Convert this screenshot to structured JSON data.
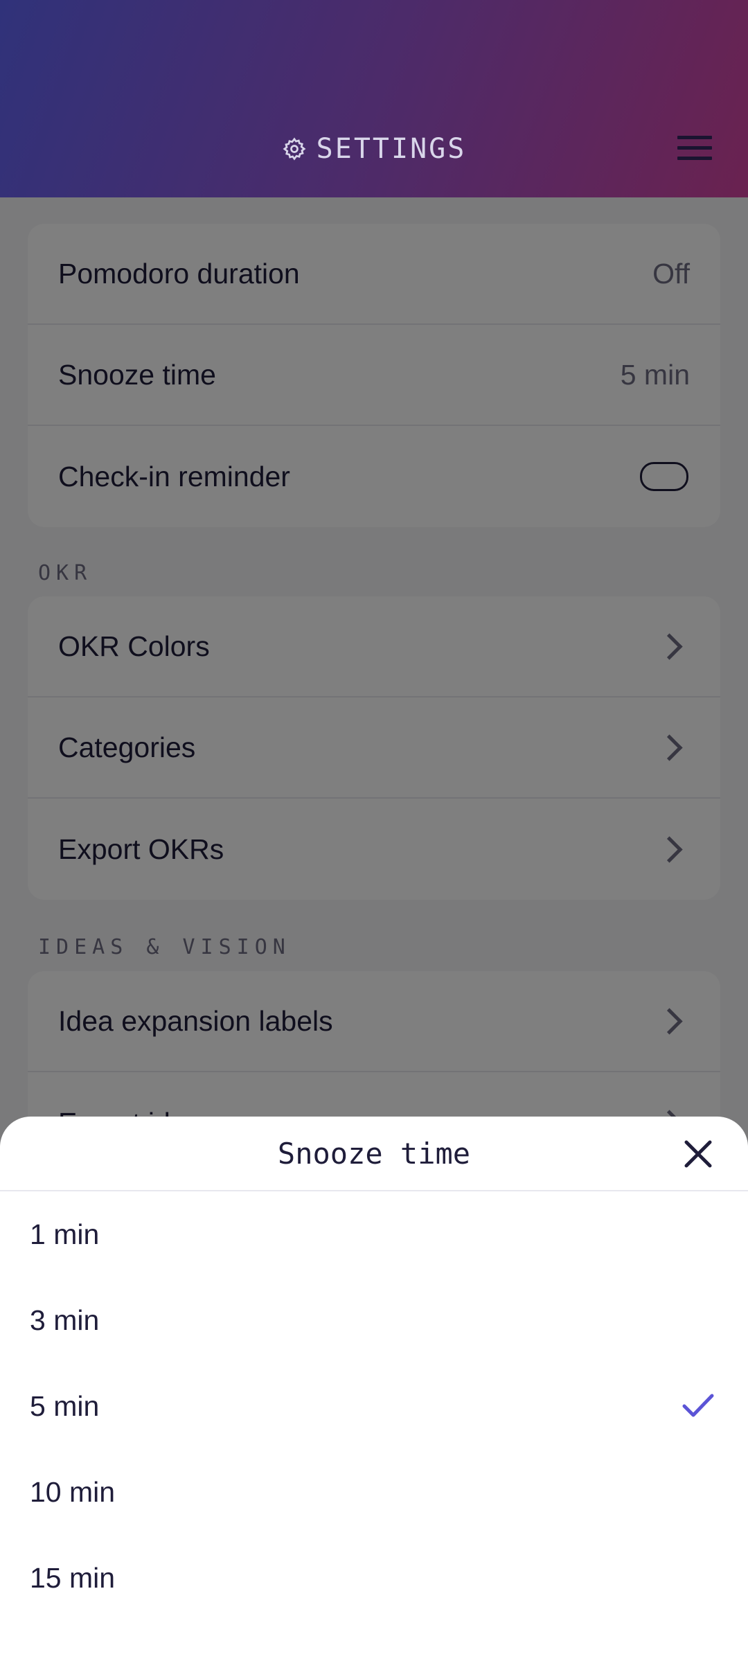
{
  "header": {
    "title": "SETTINGS",
    "icon": "gear-icon",
    "menu_icon": "menu-icon"
  },
  "general_rows": [
    {
      "label": "Pomodoro duration",
      "value": "Off"
    },
    {
      "label": "Snooze time",
      "value": "5 min"
    },
    {
      "label": "Check-in reminder",
      "toggle": "off"
    }
  ],
  "okr_section": {
    "label": "OKR",
    "items": [
      {
        "label": "OKR Colors"
      },
      {
        "label": "Categories"
      },
      {
        "label": "Export OKRs"
      }
    ]
  },
  "ideas_section": {
    "label": "IDEAS & VISION",
    "items": [
      {
        "label": "Idea expansion labels"
      },
      {
        "label": "Export ideas"
      }
    ]
  },
  "sheet": {
    "title": "Snooze time",
    "options": [
      {
        "label": "1 min",
        "selected": false
      },
      {
        "label": "3 min",
        "selected": false
      },
      {
        "label": "5 min",
        "selected": true
      },
      {
        "label": "10 min",
        "selected": false
      },
      {
        "label": "15 min",
        "selected": false
      }
    ]
  },
  "colors": {
    "accent": "#5b54d6",
    "header_start": "#30327a",
    "header_end": "#6a2250"
  }
}
